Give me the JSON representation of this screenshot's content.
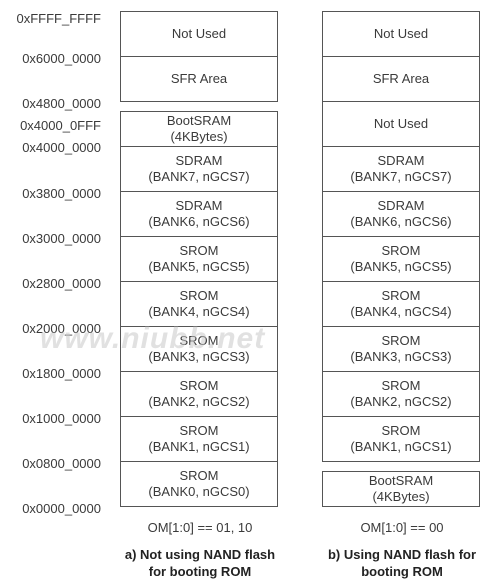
{
  "addresses": [
    "0xFFFF_FFFF",
    "0x6000_0000",
    "0x4800_0000",
    "0x4000_0FFF",
    "0x4000_0000",
    "0x3800_0000",
    "0x3000_0000",
    "0x2800_0000",
    "0x2000_0000",
    "0x1800_0000",
    "0x1000_0000",
    "0x0800_0000",
    "0x0000_0000"
  ],
  "left": {
    "blocks": [
      {
        "l1": "Not Used",
        "l2": ""
      },
      {
        "l1": "SFR Area",
        "l2": ""
      },
      {
        "l1": "BootSRAM",
        "l2": "(4KBytes)"
      },
      {
        "l1": "SDRAM",
        "l2": "(BANK7, nGCS7)"
      },
      {
        "l1": "SDRAM",
        "l2": "(BANK6, nGCS6)"
      },
      {
        "l1": "SROM",
        "l2": "(BANK5, nGCS5)"
      },
      {
        "l1": "SROM",
        "l2": "(BANK4, nGCS4)"
      },
      {
        "l1": "SROM",
        "l2": "(BANK3, nGCS3)"
      },
      {
        "l1": "SROM",
        "l2": "(BANK2, nGCS2)"
      },
      {
        "l1": "SROM",
        "l2": "(BANK1, nGCS1)"
      },
      {
        "l1": "SROM",
        "l2": "(BANK0, nGCS0)"
      }
    ],
    "mode": "OM[1:0] == 01, 10",
    "caption_line1": "a) Not using NAND flash",
    "caption_line2": "for booting ROM"
  },
  "right": {
    "blocks": [
      {
        "l1": "Not Used",
        "l2": ""
      },
      {
        "l1": "SFR Area",
        "l2": ""
      },
      {
        "l1": "Not Used",
        "l2": ""
      },
      {
        "l1": "SDRAM",
        "l2": "(BANK7, nGCS7)"
      },
      {
        "l1": "SDRAM",
        "l2": "(BANK6, nGCS6)"
      },
      {
        "l1": "SROM",
        "l2": "(BANK5, nGCS5)"
      },
      {
        "l1": "SROM",
        "l2": "(BANK4, nGCS4)"
      },
      {
        "l1": "SROM",
        "l2": "(BANK3, nGCS3)"
      },
      {
        "l1": "SROM",
        "l2": "(BANK2, nGCS2)"
      },
      {
        "l1": "SROM",
        "l2": "(BANK1, nGCS1)"
      },
      {
        "l1": "BootSRAM",
        "l2": "(4KBytes)"
      }
    ],
    "mode": "OM[1:0] == 00",
    "caption_line1": "b)  Using NAND flash for",
    "caption_line2": "booting ROM"
  },
  "watermark": "www.niubb.net"
}
